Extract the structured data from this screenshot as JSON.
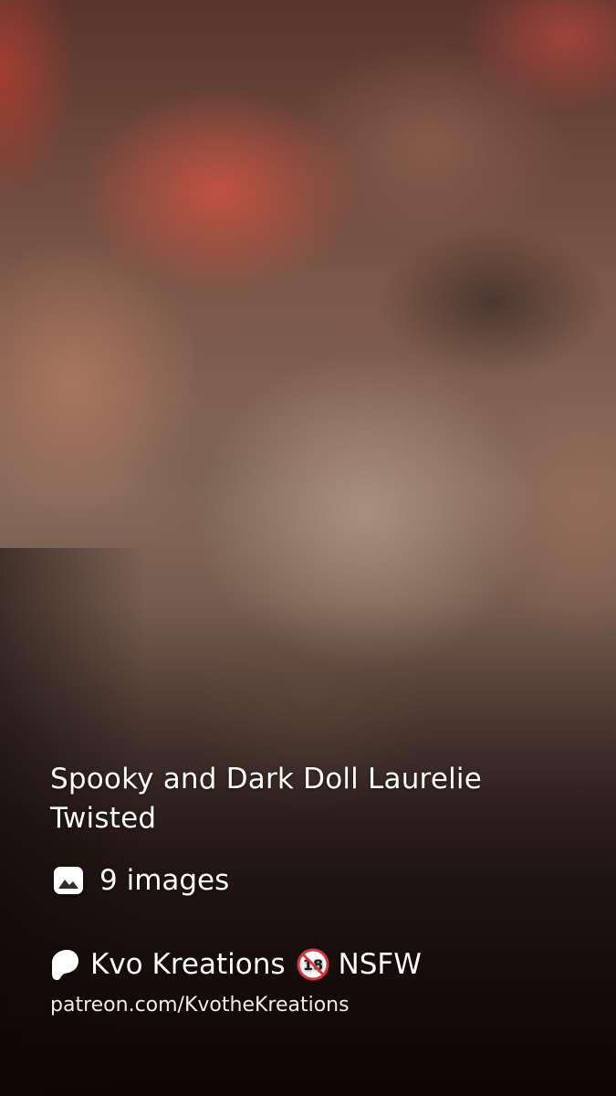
{
  "post": {
    "title": "Spooky and Dark Doll Laurelie Twisted",
    "image_count_label": "9 images",
    "image_icon": "image-icon"
  },
  "creator": {
    "icon": "patreon-icon",
    "name": "Kvo Kreations",
    "badge_icon": "no-under-18-icon",
    "badge_label": "NSFW",
    "url": "patreon.com/KvotheKreations"
  },
  "colors": {
    "text": "#ffffff",
    "badge_red": "#d8343c"
  }
}
